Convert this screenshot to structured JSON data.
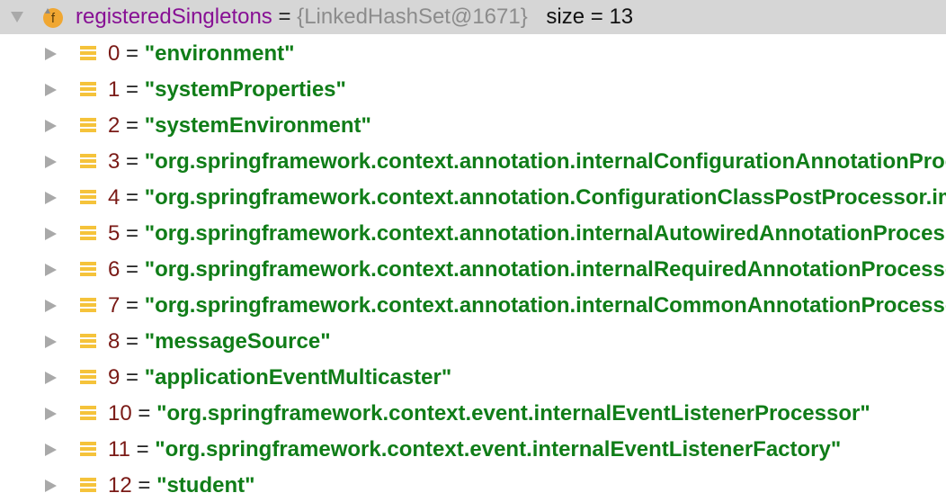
{
  "variable": {
    "name": "registeredSingletons",
    "equals": "=",
    "type": "{LinkedHashSet@1671}",
    "size": "size = 13",
    "icon": "field-f-icon",
    "toggle": "expanded-triangle-icon"
  },
  "items": [
    {
      "index": "0",
      "value": "\"environment\""
    },
    {
      "index": "1",
      "value": "\"systemProperties\""
    },
    {
      "index": "2",
      "value": "\"systemEnvironment\""
    },
    {
      "index": "3",
      "value": "\"org.springframework.context.annotation.internalConfigurationAnnotationProcessor\""
    },
    {
      "index": "4",
      "value": "\"org.springframework.context.annotation.ConfigurationClassPostProcessor.importRegistry\""
    },
    {
      "index": "5",
      "value": "\"org.springframework.context.annotation.internalAutowiredAnnotationProcessor\""
    },
    {
      "index": "6",
      "value": "\"org.springframework.context.annotation.internalRequiredAnnotationProcessor\""
    },
    {
      "index": "7",
      "value": "\"org.springframework.context.annotation.internalCommonAnnotationProcessor\""
    },
    {
      "index": "8",
      "value": "\"messageSource\""
    },
    {
      "index": "9",
      "value": "\"applicationEventMulticaster\""
    },
    {
      "index": "10",
      "value": "\"org.springframework.context.event.internalEventListenerProcessor\""
    },
    {
      "index": "11",
      "value": "\"org.springframework.context.event.internalEventListenerFactory\""
    },
    {
      "index": "12",
      "value": "\"student\""
    }
  ],
  "colors": {
    "root_background": "#d6d6d6",
    "variable_name": "#871094",
    "type": "#8c8c8c",
    "index": "#7a1a16",
    "string_value": "#107d18",
    "icon_orange": "#f0a732",
    "list_icon_yellow": "#f5c33b"
  }
}
